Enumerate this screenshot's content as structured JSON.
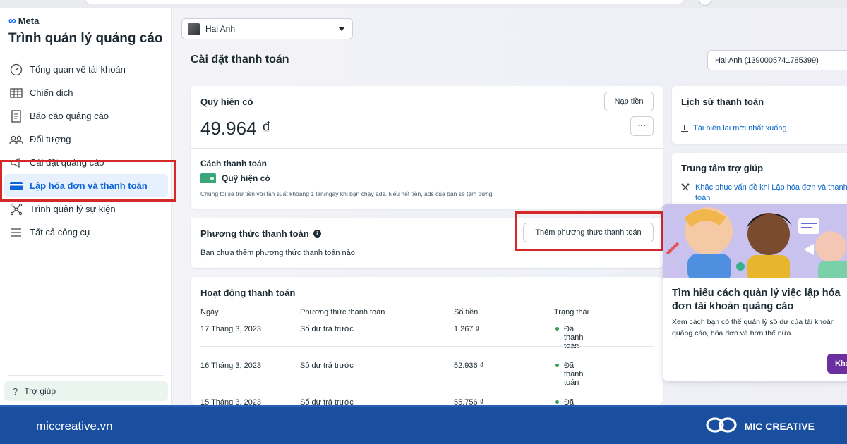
{
  "brand": {
    "meta_label": "Meta",
    "app_title": "Trình quản lý quảng cáo"
  },
  "sidebar": {
    "items": [
      {
        "label": "Tổng quan về tài khoản",
        "icon": "gauge-icon"
      },
      {
        "label": "Chiến dịch",
        "icon": "table-icon"
      },
      {
        "label": "Báo cáo quảng cáo",
        "icon": "report-icon"
      },
      {
        "label": "Đối tượng",
        "icon": "people-icon"
      },
      {
        "label": "Cài đặt quảng cáo",
        "icon": "megaphone-icon"
      },
      {
        "label": "Lập hóa đơn và thanh toán",
        "icon": "credit-card-icon",
        "active": true
      },
      {
        "label": "Trình quản lý sự kiện",
        "icon": "network-icon"
      },
      {
        "label": "Tất cả công cụ",
        "icon": "menu-icon"
      }
    ],
    "help_label": "Trợ giúp"
  },
  "header": {
    "account_name": "Hai Anh",
    "page_title": "Cài đặt thanh toán",
    "account_id": "Hai Anh (1390005741785399)"
  },
  "funds": {
    "title": "Quỹ hiện có",
    "amount": "49.964 ₫",
    "add_funds_label": "Nạp tiền",
    "more_label": "···",
    "payment_method_heading": "Cách thanh toán",
    "payment_method_name": "Quỹ hiện có",
    "note": "Chúng tôi sẽ trừ tiền với tần suất khoảng 1 lần/ngày khi bạn chạy ads. Nếu hết tiền, ads của bạn sẽ tạm dừng."
  },
  "methods": {
    "title": "Phương thức thanh toán",
    "info_symbol": "i",
    "add_label": "Thêm phương thức thanh toán",
    "empty_text": "Bạn chưa thêm phương thức thanh toán nào."
  },
  "activity": {
    "title": "Hoạt động thanh toán",
    "columns": [
      "Ngày",
      "Phương thức thanh toán",
      "Số tiền",
      "Trạng thái"
    ],
    "rows": [
      {
        "date": "17 Tháng 3, 2023",
        "method": "Số dư trả trước",
        "amount": "1.267 ₫",
        "status": "Đã thanh toán"
      },
      {
        "date": "16 Tháng 3, 2023",
        "method": "Số dư trả trước",
        "amount": "52.936 ₫",
        "status": "Đã thanh toán"
      },
      {
        "date": "15 Tháng 3, 2023",
        "method": "Số dư trả trước",
        "amount": "55.756 ₫",
        "status": "Đã thanh toán"
      }
    ]
  },
  "history": {
    "title": "Lịch sử thanh toán",
    "download_label": "Tải biên lai mới nhất xuống"
  },
  "help_center": {
    "title": "Trung tâm trợ giúp",
    "link_label": "Khắc phục vấn đề khi Lập hóa đơn và thanh toán"
  },
  "promo": {
    "title": "Tìm hiểu cách quản lý việc lập hóa đơn tài khoản quảng cáo",
    "text": "Xem cách bạn có thể quản lý số dư của tài khoản quảng cáo, hóa đơn và hơn thế nữa.",
    "button_label": "Khám"
  },
  "footer": {
    "url": "miccreative.vn",
    "brand": "MIC CREATIVE"
  },
  "colors": {
    "highlight_border": "#d62828",
    "accent_blue": "#0a66c8",
    "footer_bg": "#1a4fa0",
    "promo_button": "#6b2fa0"
  }
}
